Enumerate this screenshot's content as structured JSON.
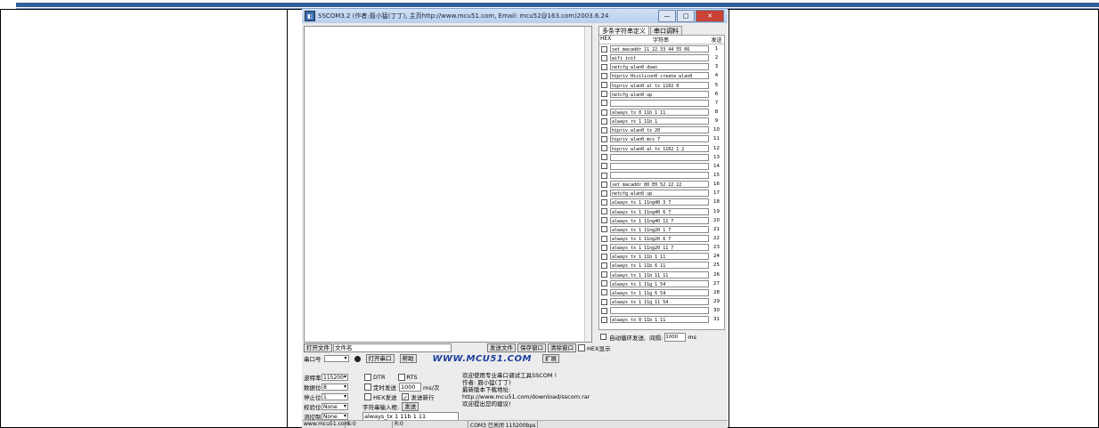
{
  "window": {
    "title": "SSCOM3.2 (作者:聂小猛(丁丁), 主页http://www.mcu51.com,  Email: mcu52@163.com)2003.6.24",
    "icon": "app-icon",
    "min": "—",
    "max": "□",
    "close": "✕"
  },
  "panel": {
    "tabs": [
      "多条字符串定义",
      "串口调料"
    ],
    "header": {
      "hex": "HEX",
      "string": "字符串",
      "send": "发送"
    },
    "rows": [
      {
        "text": "set_macaddr 11 22 33 44 55 66",
        "num": "1"
      },
      {
        "text": "wifi_init",
        "num": "2"
      },
      {
        "text": "netcfg wlan0 down",
        "num": "3"
      },
      {
        "text": "hipriv Hisilicon0 create wlan0",
        "num": "4"
      },
      {
        "text": "hipriv wlan0 al_tx_1102 0",
        "num": "5"
      },
      {
        "text": "netcfg wlan0 up",
        "num": "6"
      },
      {
        "text": "",
        "num": "7"
      },
      {
        "text": "always_tx 0 11b 1 11",
        "num": "8"
      },
      {
        "text": "always_rx 1 11b 1",
        "num": "9"
      },
      {
        "text": "hipriv wlan0 tx 20",
        "num": "10"
      },
      {
        "text": "hipriv wlan0 mcs 7",
        "num": "11"
      },
      {
        "text": "hipriv wlan0 al_tx_1102 1 2",
        "num": "12"
      },
      {
        "text": "",
        "num": "13"
      },
      {
        "text": "",
        "num": "14"
      },
      {
        "text": "",
        "num": "15"
      },
      {
        "text": "set_macaddr 00 E0 52 22 22",
        "num": "16"
      },
      {
        "text": "netcfg wlan0 up",
        "num": "17"
      },
      {
        "text": "always_tx 1 11ng40 3 7",
        "num": "18"
      },
      {
        "text": "always_tx 1 11ng40 6 7",
        "num": "19"
      },
      {
        "text": "always_tx 1 11ng40 11 7",
        "num": "20"
      },
      {
        "text": "always_tx 1 11ng20 1 7",
        "num": "21"
      },
      {
        "text": "always_tx 1 11ng20 6 7",
        "num": "22"
      },
      {
        "text": "always_tx 1 11ng20 11 7",
        "num": "23"
      },
      {
        "text": "always_tx 1 11b 1 11",
        "num": "24"
      },
      {
        "text": "always_tx 1 11b 6 11",
        "num": "25"
      },
      {
        "text": "always_tx 1 11b 11 11",
        "num": "26"
      },
      {
        "text": "always_tx 1 11g 1 54",
        "num": "27"
      },
      {
        "text": "always_tx 1 11g 6 54",
        "num": "28"
      },
      {
        "text": "always_tx 1 11g 11 54",
        "num": "29"
      },
      {
        "text": "",
        "num": "30"
      },
      {
        "text": "always_tx 0 11b 1 11",
        "num": "31"
      }
    ],
    "auto_loop_label": "自动循环发送,",
    "period_label": "间隔:",
    "period_value": "1000",
    "period_unit": "ms"
  },
  "bottom": {
    "open_file": "打开文件",
    "filename": "文件名",
    "send_file": "发送文件",
    "save_window": "保存窗口",
    "clear_window": "清除窗口",
    "hex_display": "HEX显示",
    "port_label": "串口号",
    "open_port": "打开串口",
    "help": "帮助",
    "brand": "WWW.MCU51.COM",
    "expand": "扩展",
    "baud_label": "波特率",
    "baud_value": "115200",
    "databits_label": "数据位",
    "databits_value": "8",
    "stopbits_label": "停止位",
    "stopbits_value": "1",
    "parity_label": "校验位",
    "parity_value": "None",
    "flow_label": "流控制",
    "flow_value": "None",
    "dtr": "DTR",
    "rts": "RTS",
    "timed_send": "定时发送",
    "timed_value": "1000",
    "timed_unit": "ms/次",
    "hex_send": "HEX发送",
    "send_newline": "发送新行",
    "input_label": "字符串输入框:",
    "send": "发送",
    "send_input": "always_tx 1 11b 1 11",
    "info": [
      "欢迎使用专业串口调试工具SSCOM !",
      "作者: 聂小猛(丁丁)",
      "最新版本下载地址:",
      "http://www.mcu51.com/download/sscom.rar",
      "欢迎提出您的建议!"
    ]
  },
  "statusbar": {
    "site": "www.mcu51.com",
    "s": "S:0",
    "r": "R:0",
    "port_status": "COM3 已关闭  115200bps"
  }
}
